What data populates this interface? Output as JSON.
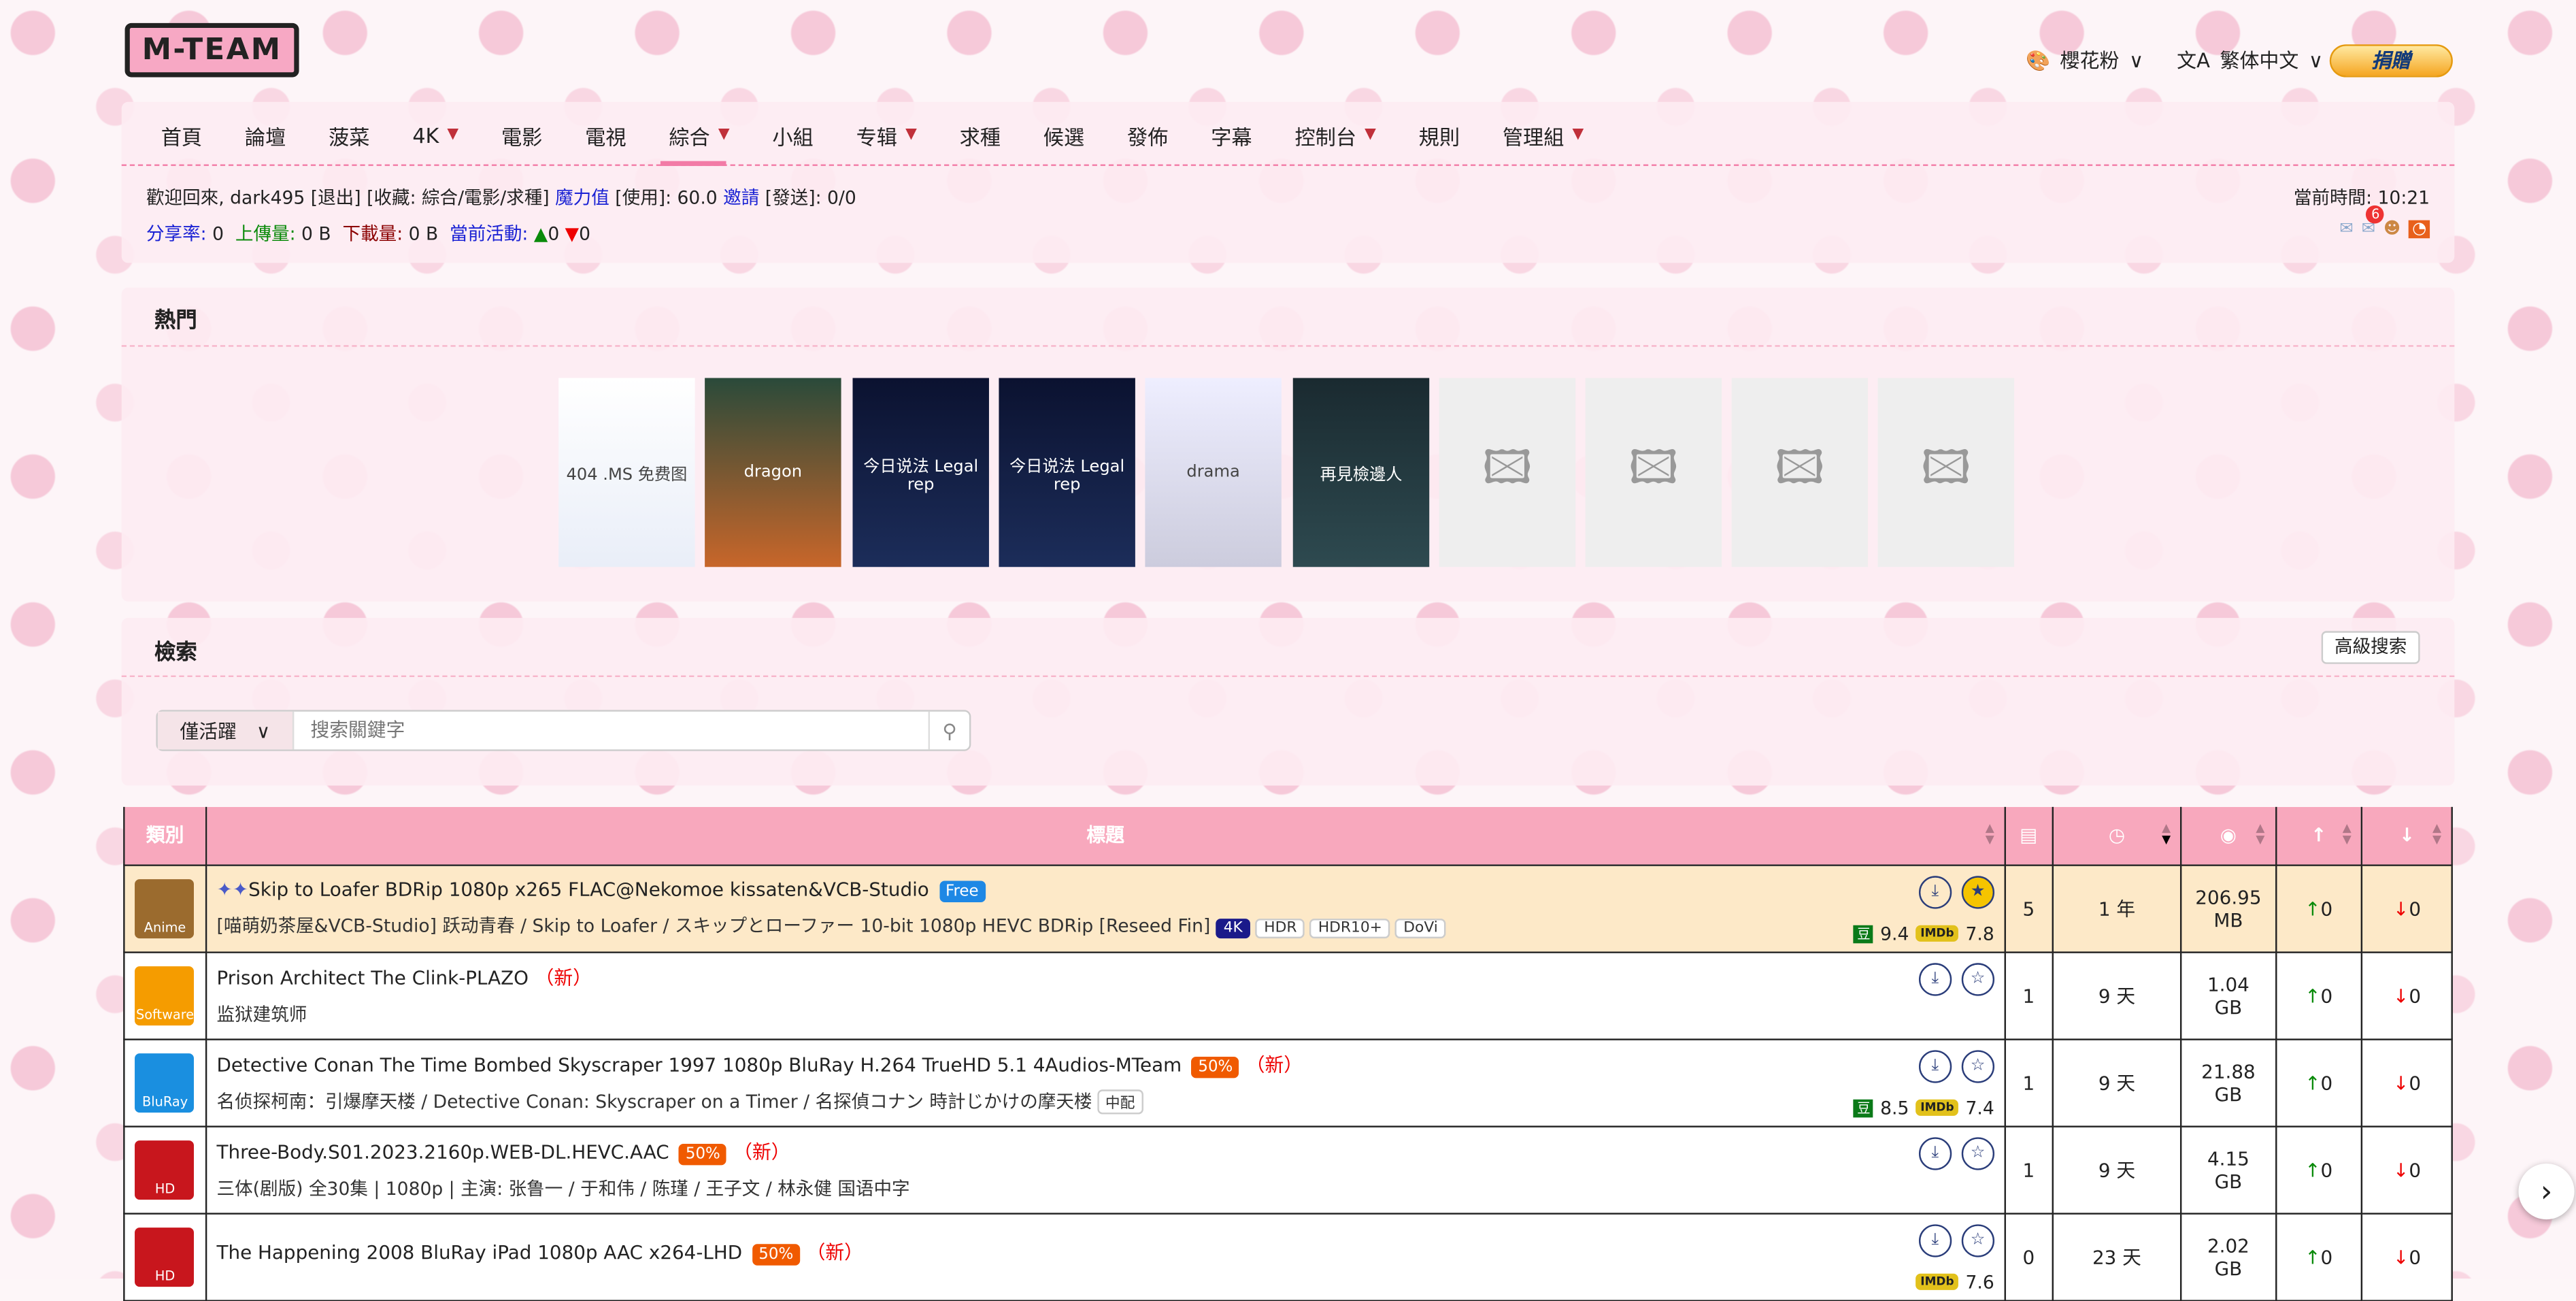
{
  "logo": "M-TEAM",
  "top": {
    "theme": "櫻花粉",
    "language": "繁体中文",
    "donate": "捐贈"
  },
  "nav": [
    {
      "label": "首頁"
    },
    {
      "label": "論壇"
    },
    {
      "label": "菠菜"
    },
    {
      "label": "4K",
      "dropdown": true
    },
    {
      "label": "電影"
    },
    {
      "label": "電視"
    },
    {
      "label": "綜合",
      "dropdown": true,
      "active": true
    },
    {
      "label": "小組"
    },
    {
      "label": "专辑",
      "dropdown": true
    },
    {
      "label": "求種"
    },
    {
      "label": "候選"
    },
    {
      "label": "發佈"
    },
    {
      "label": "字幕"
    },
    {
      "label": "控制台",
      "dropdown": true
    },
    {
      "label": "規則"
    },
    {
      "label": "管理組",
      "dropdown": true
    }
  ],
  "user": {
    "welcome": "歡迎回來, dark495",
    "logout": "[退出]",
    "fav": "[收藏: 綜合/電影/求種]",
    "bonus": "魔力值",
    "used": "[使用]: 60.0",
    "invite": "邀請",
    "sent": "[發送]: 0/0",
    "ratio_label": "分享率:",
    "ratio": "0",
    "up_label": "上傳量:",
    "up": "0 B",
    "down_label": "下載量:",
    "down": "0 B",
    "active_label": "當前活動:",
    "seeding": "0",
    "leeching": "0",
    "time": "當前時間: 10:21",
    "msg_count": "6"
  },
  "hot": {
    "title": "熱門",
    "posters": [
      "404 .MS 免费图",
      "dragon",
      "今日说法 Legal rep",
      "今日说法 Legal rep",
      "drama",
      "再見檢邊人",
      "",
      "",
      "",
      ""
    ]
  },
  "search": {
    "title": "檢索",
    "advanced": "高級搜索",
    "filter": "僅活躍",
    "placeholder": "搜索關鍵字"
  },
  "table": {
    "headers": {
      "category": "類別",
      "title": "標題"
    },
    "rows": [
      {
        "cat": "Anime",
        "color": "#9b6b2e",
        "title": "Skip to Loafer BDRip 1080p x265 FLAC@Nekomoe kissaten&VCB-Studio",
        "badge": "Free",
        "badge_color": "#1e88e5",
        "new": "",
        "sub": "[喵萌奶茶屋&VCB-Studio] 跃动青春 / Skip to Loafer / スキップとローファー 10-bit 1080p HEVC BDRip [Reseed Fin]",
        "tags": [
          "4K",
          "HDR",
          "HDR10+",
          "DoVi"
        ],
        "douban": "9.4",
        "imdb": "7.8",
        "comments": "5",
        "time": "1 年",
        "size": "206.95 MB",
        "seed": "0",
        "leech": "0",
        "highlight": true,
        "starred": true
      },
      {
        "cat": "Software",
        "color": "#f59c00",
        "title": "Prison Architect The Clink-PLAZO",
        "badge": "",
        "new": "（新）",
        "sub": "监狱建筑师",
        "tags": [],
        "douban": "",
        "imdb": "",
        "comments": "1",
        "time": "9 天",
        "size": "1.04 GB",
        "seed": "0",
        "leech": "0"
      },
      {
        "cat": "BluRay",
        "color": "#1a8fe0",
        "title": "Detective Conan The Time Bombed Skyscraper 1997 1080p BluRay H.264 TrueHD 5.1 4Audios-MTeam",
        "badge": "50%",
        "badge_color": "#f05a00",
        "new": "（新）",
        "sub": "名侦探柯南：引爆摩天楼 / Detective Conan: Skyscraper on a Timer / 名探偵コナン 時計じかけの摩天楼",
        "tags": [
          "中配"
        ],
        "douban": "8.5",
        "imdb": "7.4",
        "comments": "1",
        "time": "9 天",
        "size": "21.88 GB",
        "seed": "0",
        "leech": "0"
      },
      {
        "cat": "HD",
        "color": "#c8161d",
        "title": "Three-Body.S01.2023.2160p.WEB-DL.HEVC.AAC",
        "badge": "50%",
        "badge_color": "#f05a00",
        "new": "（新）",
        "sub": "三体(剧版) 全30集 | 1080p | 主演: 张鲁一 / 于和伟 / 陈瑾 / 王子文 / 林永健 国语中字",
        "tags": [],
        "douban": "",
        "imdb": "",
        "comments": "1",
        "time": "9 天",
        "size": "4.15 GB",
        "seed": "0",
        "leech": "0"
      },
      {
        "cat": "HD",
        "color": "#c8161d",
        "title": "The Happening 2008 BluRay iPad 1080p AAC x264-LHD",
        "badge": "50%",
        "badge_color": "#f05a00",
        "new": "（新）",
        "sub": "",
        "tags": [],
        "douban": "",
        "imdb": "7.6",
        "comments": "0",
        "time": "23 天",
        "size": "2.02 GB",
        "seed": "0",
        "leech": "0"
      }
    ]
  },
  "colors": {
    "accent": "#f27ba6",
    "header_bg": "#f8a8bd",
    "highlight_row": "#fde9c8"
  }
}
